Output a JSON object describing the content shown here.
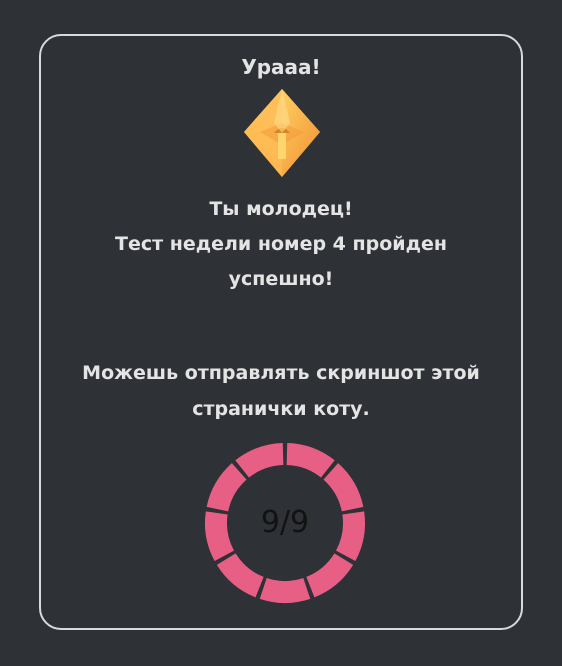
{
  "title": "Урааа!",
  "message_lines": [
    "Ты молодец!",
    "Тест недели номер 4 пройден",
    "успешно!"
  ],
  "note_lines": [
    "Можешь отправлять скриншот этой",
    "странички коту."
  ],
  "progress": {
    "label": "9/9",
    "completed": 9,
    "total": 9,
    "segment_color": "#e85f85"
  },
  "icon": "crystal-icon"
}
